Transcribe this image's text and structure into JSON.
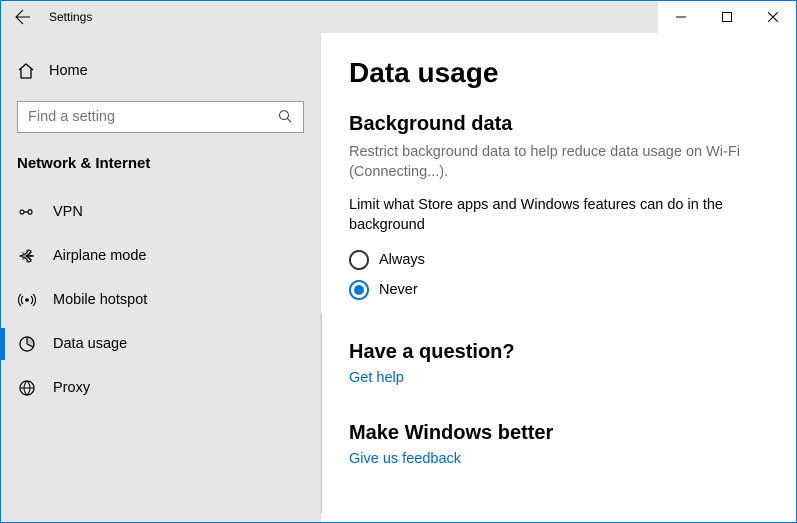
{
  "titlebar": {
    "app_title": "Settings"
  },
  "home_label": "Home",
  "search": {
    "placeholder": "Find a setting"
  },
  "category_header": "Network & Internet",
  "nav": {
    "items": [
      {
        "label": "VPN"
      },
      {
        "label": "Airplane mode"
      },
      {
        "label": "Mobile hotspot"
      },
      {
        "label": "Data usage"
      },
      {
        "label": "Proxy"
      }
    ]
  },
  "main": {
    "page_title": "Data usage",
    "bg_data": {
      "heading": "Background data",
      "desc": "Restrict background data to help reduce data usage on Wi-Fi (Connecting...).",
      "sub": "Limit what Store apps and Windows features can do in the background",
      "options": {
        "always": "Always",
        "never": "Never"
      }
    },
    "question": {
      "heading": "Have a question?",
      "link": "Get help"
    },
    "feedback": {
      "heading": "Make Windows better",
      "link": "Give us feedback"
    }
  }
}
